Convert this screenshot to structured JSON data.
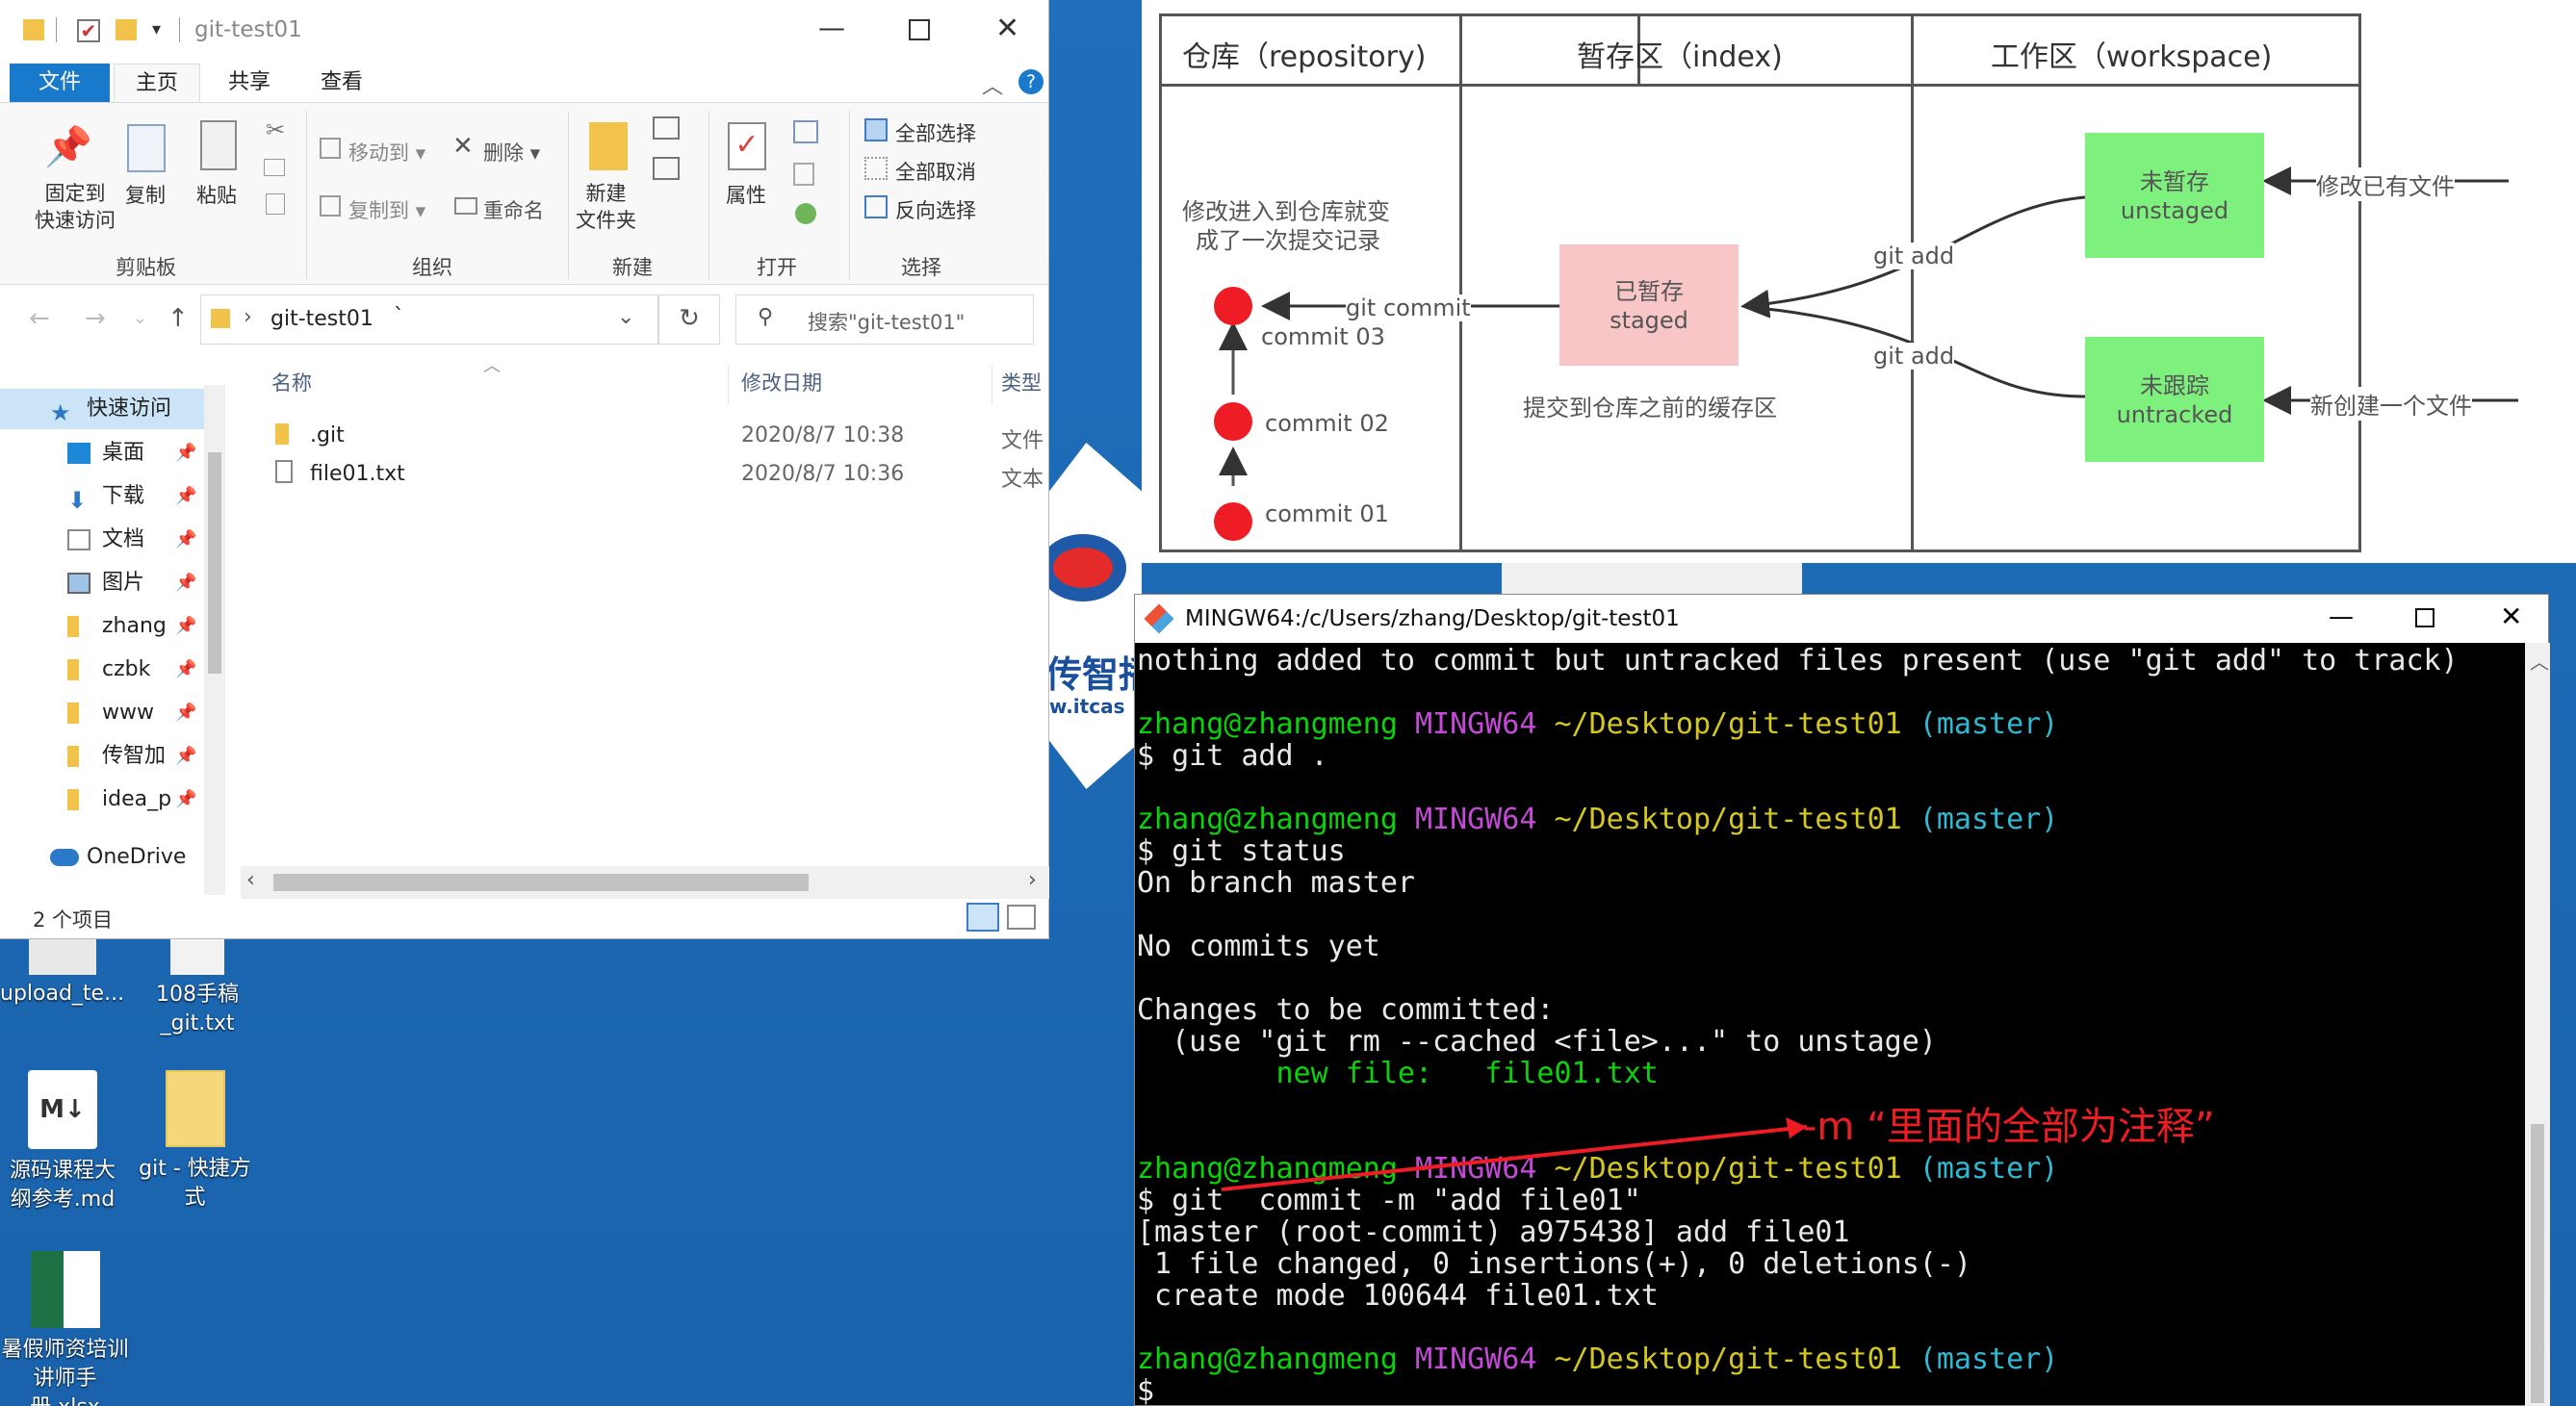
{
  "explorer": {
    "title": "git-test01",
    "tabs": [
      "文件",
      "主页",
      "共享",
      "查看"
    ],
    "ribbon": {
      "pin_label_1": "固定到",
      "pin_label_2": "快速访问",
      "copy": "复制",
      "paste": "粘贴",
      "move_to": "移动到",
      "copy_to": "复制到",
      "delete": "删除",
      "rename": "重命名",
      "new_folder_1": "新建",
      "new_folder_2": "文件夹",
      "properties": "属性",
      "select_all": "全部选择",
      "select_none": "全部取消",
      "invert": "反向选择",
      "groups": [
        "剪贴板",
        "组织",
        "新建",
        "打开",
        "选择"
      ]
    },
    "address": "git-test01",
    "address_caret": "`",
    "search_placeholder": "搜索\"git-test01\"",
    "nav": {
      "quick_access": "快速访问",
      "items": [
        "桌面",
        "下载",
        "文档",
        "图片",
        "zhang",
        "czbk",
        "www",
        "传智加",
        "idea_p"
      ],
      "onedrive": "OneDrive"
    },
    "columns": {
      "name": "名称",
      "date": "修改日期",
      "type": "类型"
    },
    "files": [
      {
        "name": ".git",
        "date": "2020/8/7 10:38",
        "type": "文件"
      },
      {
        "name": "file01.txt",
        "date": "2020/8/7 10:36",
        "type": "文本"
      }
    ],
    "status": "2 个项目"
  },
  "diagram": {
    "headers": [
      "仓库（repository)",
      "暂存区（index)",
      "工作区（workspace)"
    ],
    "repo_note_1": "修改进入到仓库就变",
    "repo_note_2": "成了一次提交记录",
    "commits": [
      "commit  03",
      "commit  02",
      "commit  01"
    ],
    "git_commit": "git commit",
    "staged_1": "已暂存",
    "staged_2": "staged",
    "index_note": "提交到仓库之前的缓存区",
    "git_add_1": "git add",
    "git_add_2": "git add",
    "unstaged_1": "未暂存",
    "unstaged_2": "unstaged",
    "untracked_1": "未跟踪",
    "untracked_2": "untracked",
    "modify_existing": "修改已有文件",
    "create_new": "新创建一个文件",
    "colors": {
      "node": "#ee1c24",
      "staged": "#f8c6c6",
      "work": "#7ef07e"
    }
  },
  "terminal": {
    "title": "MINGW64:/c/Users/zhang/Desktop/git-test01",
    "user": "zhang@zhangmeng",
    "env": "MINGW64",
    "path": "~/Desktop/git-test01",
    "branch": "(master)",
    "lines": {
      "l1": "nothing added to commit but untracked files present (use \"git add\" to track)",
      "cmd_add": "$ git add .",
      "cmd_status": "$ git status",
      "on_branch": "On branch master",
      "no_commits": "No commits yet",
      "changes": "Changes to be committed:",
      "use_rm": "  (use \"git rm --cached <file>...\" to unstage)",
      "new_file": "        new file:   file01.txt",
      "cmd_commit": "$ git  commit -m \"add file01\"",
      "result1": "[master (root-commit) a975438] add file01",
      "result2": " 1 file changed, 0 insertions(+), 0 deletions(-)",
      "result3": " create mode 100644 file01.txt",
      "prompt": "$"
    },
    "annotation": "-m “里面的全部为注释”"
  },
  "desktop": {
    "icons": [
      {
        "label": "upload_te..."
      },
      {
        "label": "108手稿_git.txt"
      },
      {
        "label": "源码课程大纲参考.md"
      },
      {
        "label": "git - 快捷方式"
      },
      {
        "label": "暑假师资培训讲师手册.xlsx"
      }
    ],
    "logo_text": "传智播",
    "logo_url": "w.itcas"
  }
}
